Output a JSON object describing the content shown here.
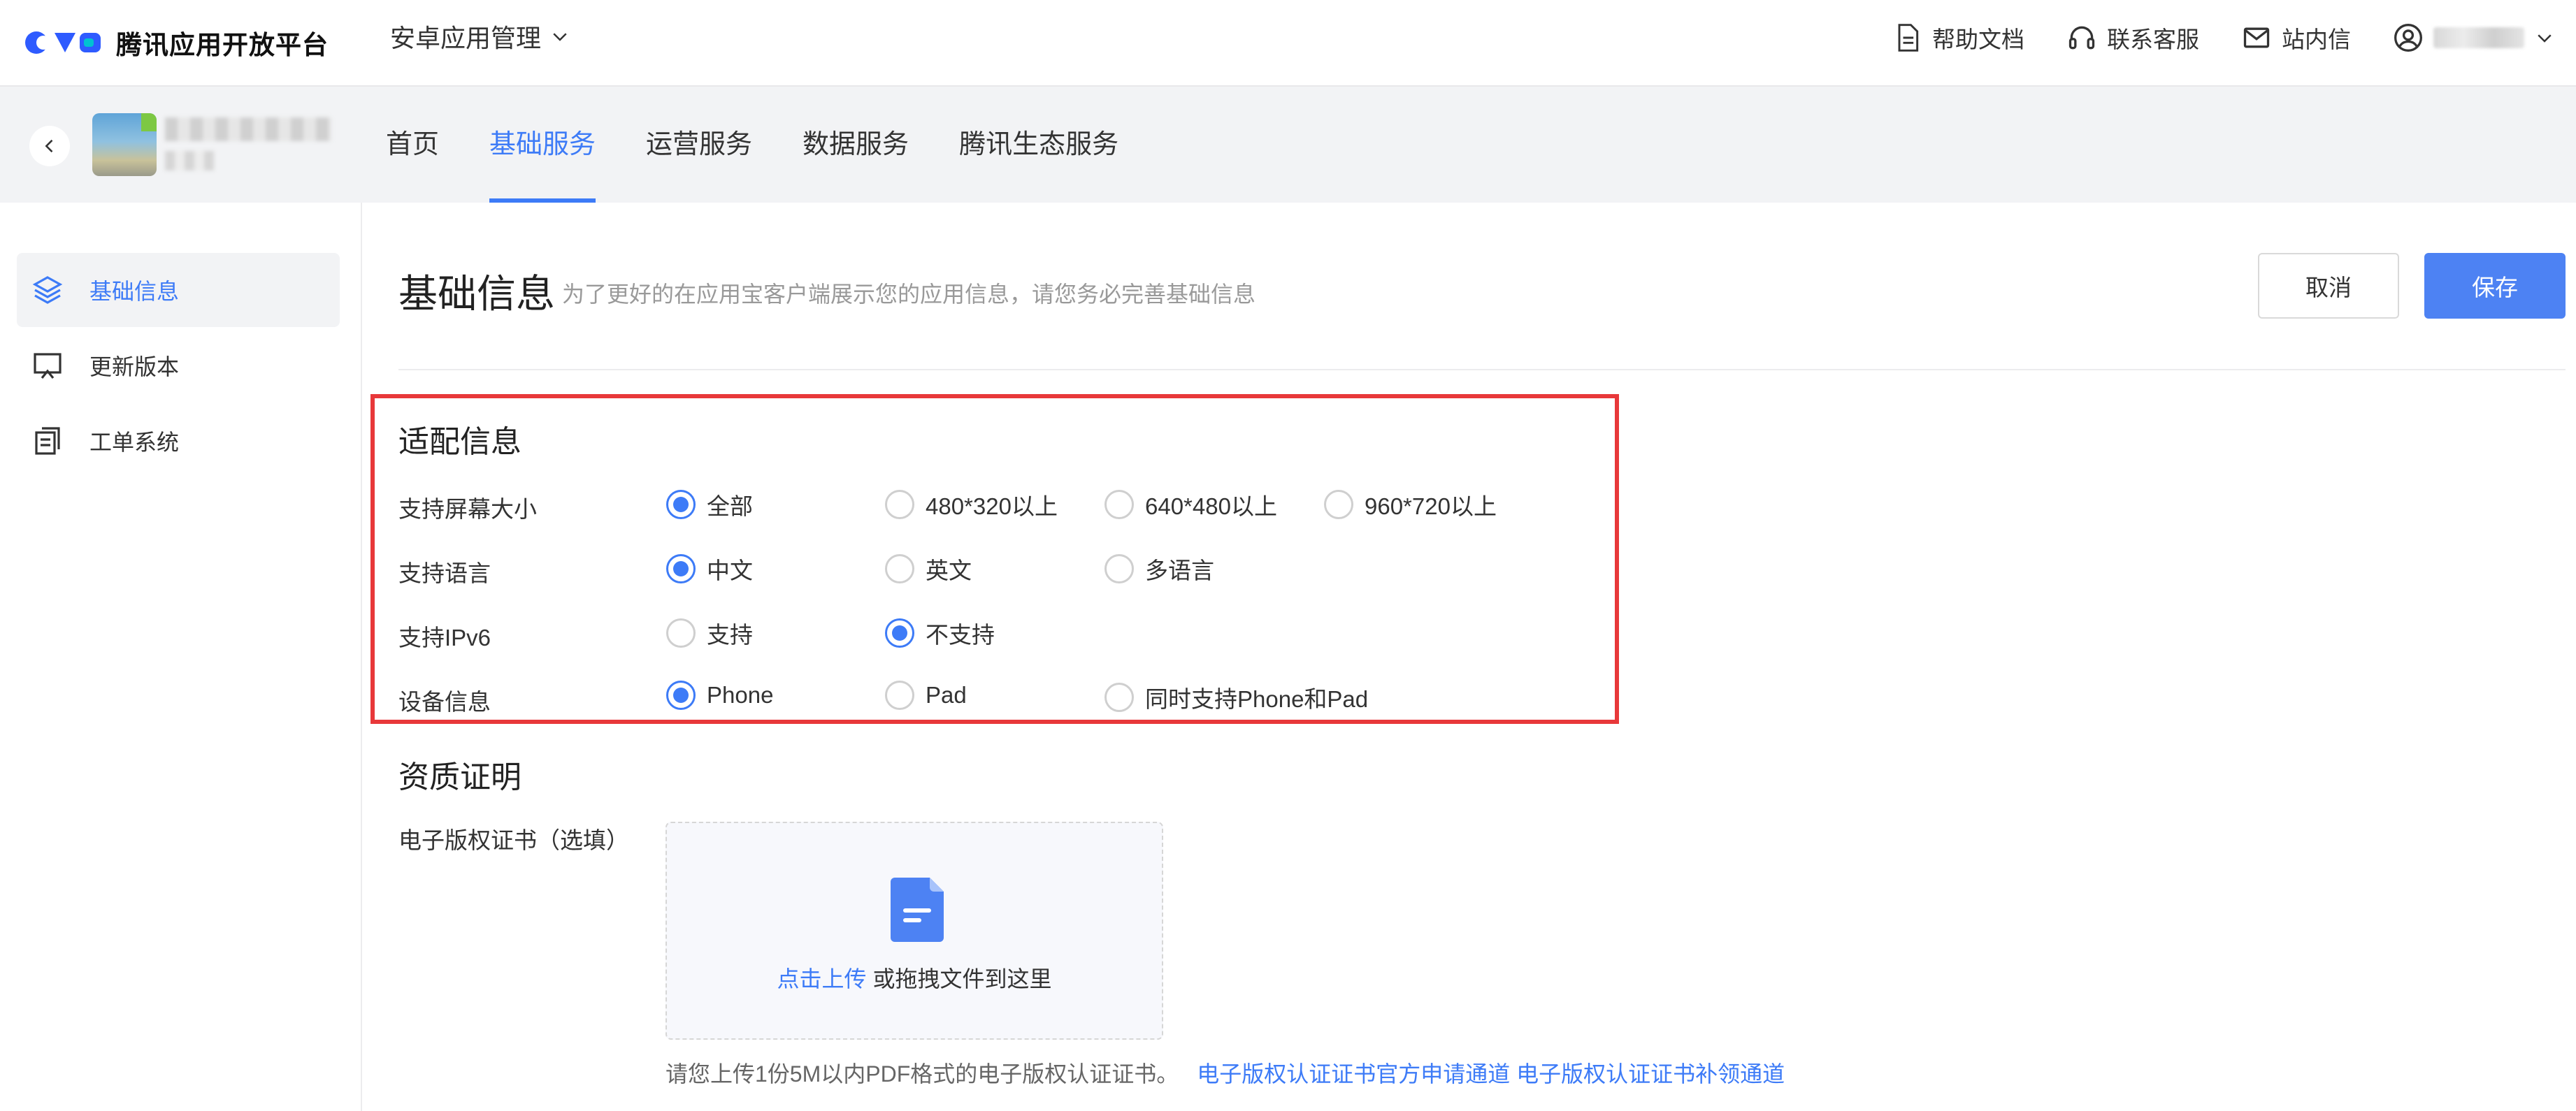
{
  "header": {
    "logo_text": "腾讯应用开放平台",
    "app_switch_label": "安卓应用管理",
    "help_docs": "帮助文档",
    "customer_service": "联系客服",
    "inbox": "站内信"
  },
  "subnav": {
    "tabs": [
      {
        "label": "首页"
      },
      {
        "label": "基础服务"
      },
      {
        "label": "运营服务"
      },
      {
        "label": "数据服务"
      },
      {
        "label": "腾讯生态服务"
      }
    ],
    "active_tab": "基础服务"
  },
  "sidebar": {
    "items": [
      {
        "label": "基础信息",
        "icon": "layers-icon"
      },
      {
        "label": "更新版本",
        "icon": "monitor-upload-icon"
      },
      {
        "label": "工单系统",
        "icon": "documents-icon"
      }
    ],
    "active_item": "基础信息"
  },
  "main": {
    "title": "基础信息",
    "description": "为了更好的在应用宝客户端展示您的应用信息，请您务必完善基础信息",
    "cancel_label": "取消",
    "save_label": "保存"
  },
  "adapt": {
    "title": "适配信息",
    "screen": {
      "label": "支持屏幕大小",
      "options": [
        "全部",
        "480*320以上",
        "640*480以上",
        "960*720以上"
      ],
      "selected": "全部"
    },
    "language": {
      "label": "支持语言",
      "options": [
        "中文",
        "英文",
        "多语言"
      ],
      "selected": "中文"
    },
    "ipv6": {
      "label": "支持IPv6",
      "options": [
        "支持",
        "不支持"
      ],
      "selected": "不支持"
    },
    "device": {
      "label": "设备信息",
      "options": [
        "Phone",
        "Pad",
        "同时支持Phone和Pad"
      ],
      "selected": "Phone"
    }
  },
  "qualification": {
    "title": "资质证明",
    "copyright_label": "电子版权证书（选填）",
    "upload_link": "点击上传",
    "upload_text": "或拖拽文件到这里",
    "hint": "请您上传1份5M以内PDF格式的电子版权认证证书。",
    "apply_link": "电子版权认证证书官方申请通道",
    "supplement_link": "电子版权认证证书补领通道"
  },
  "colors": {
    "accent": "#3d7bf7",
    "save_button": "#4d82f3",
    "highlight_border": "#e8383a",
    "subnav_bg": "#f2f3f5"
  }
}
